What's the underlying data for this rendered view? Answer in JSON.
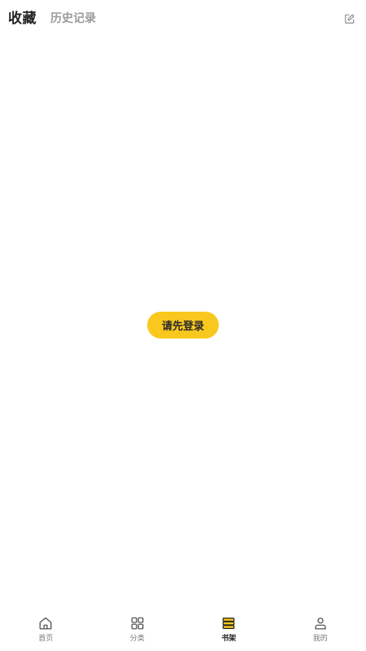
{
  "header": {
    "tabs": [
      {
        "label": "收藏",
        "active": true
      },
      {
        "label": "历史记录",
        "active": false
      }
    ],
    "edit_icon": "edit-icon"
  },
  "main": {
    "login_button_label": "请先登录"
  },
  "bottom_nav": {
    "items": [
      {
        "label": "首页",
        "icon": "home-icon",
        "active": false
      },
      {
        "label": "分类",
        "icon": "grid-icon",
        "active": false
      },
      {
        "label": "书架",
        "icon": "bookshelf-icon",
        "active": true
      },
      {
        "label": "我的",
        "icon": "user-icon",
        "active": false
      }
    ]
  },
  "colors": {
    "accent": "#f9c81e",
    "text_primary": "#222222",
    "text_secondary": "#9a9a9a"
  }
}
